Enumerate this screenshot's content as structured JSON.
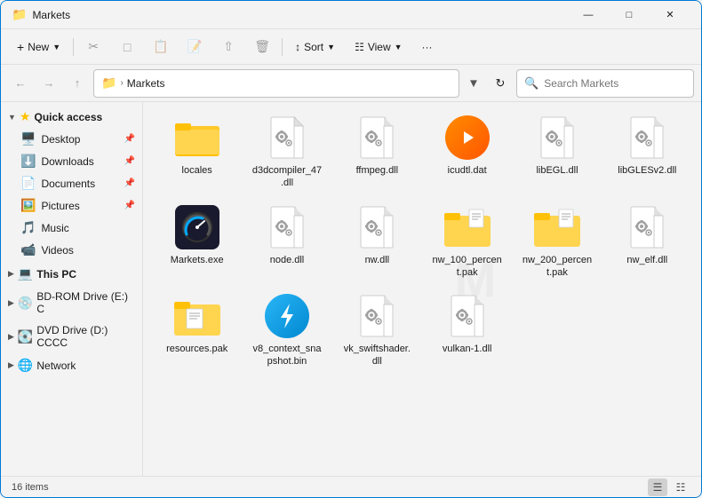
{
  "window": {
    "title": "Markets",
    "icon": "📁"
  },
  "toolbar": {
    "new_label": "New",
    "sort_label": "Sort",
    "view_label": "View",
    "more_label": "···"
  },
  "addressbar": {
    "path_folder": "Markets",
    "search_placeholder": "Search Markets"
  },
  "sidebar": {
    "quick_access_label": "Quick access",
    "items": [
      {
        "id": "desktop",
        "label": "Desktop",
        "icon": "🖥️",
        "pinned": true
      },
      {
        "id": "downloads",
        "label": "Downloads",
        "icon": "⬇️",
        "pinned": true
      },
      {
        "id": "documents",
        "label": "Documents",
        "icon": "📄",
        "pinned": true
      },
      {
        "id": "pictures",
        "label": "Pictures",
        "icon": "🖼️",
        "pinned": true
      },
      {
        "id": "music",
        "label": "Music",
        "icon": "🎵",
        "pinned": false
      },
      {
        "id": "videos",
        "label": "Videos",
        "icon": "📹",
        "pinned": false
      }
    ],
    "this_pc_label": "This PC",
    "bdrom_label": "BD-ROM Drive (E:) C",
    "dvd_label": "DVD Drive (D:) CCCC",
    "network_label": "Network"
  },
  "files": [
    {
      "id": "locales",
      "name": "locales",
      "type": "folder"
    },
    {
      "id": "d3dcompiler",
      "name": "d3dcompiler_47.dll",
      "type": "dll"
    },
    {
      "id": "ffmpeg",
      "name": "ffmpeg.dll",
      "type": "dll"
    },
    {
      "id": "icudtl",
      "name": "icudtl.dat",
      "type": "media"
    },
    {
      "id": "libEGL",
      "name": "libEGL.dll",
      "type": "dll"
    },
    {
      "id": "libGLESv2",
      "name": "libGLESv2.dll",
      "type": "dll"
    },
    {
      "id": "markets_exe",
      "name": "Markets.exe",
      "type": "exe"
    },
    {
      "id": "node",
      "name": "node.dll",
      "type": "dll"
    },
    {
      "id": "nw",
      "name": "nw.dll",
      "type": "dll"
    },
    {
      "id": "nw_100",
      "name": "nw_100_percent.pak",
      "type": "pak"
    },
    {
      "id": "nw_200",
      "name": "nw_200_percent.pak",
      "type": "pak"
    },
    {
      "id": "nw_elf",
      "name": "nw_elf.dll",
      "type": "dll"
    },
    {
      "id": "resources",
      "name": "resources.pak",
      "type": "pak_file"
    },
    {
      "id": "v8_context",
      "name": "v8_context_snapshot.bin",
      "type": "bolt"
    },
    {
      "id": "vk_swiftshader",
      "name": "vk_swiftshader.dll",
      "type": "dll"
    },
    {
      "id": "vulkan",
      "name": "vulkan-1.dll",
      "type": "dll"
    }
  ],
  "statusbar": {
    "count_text": "16 items"
  }
}
